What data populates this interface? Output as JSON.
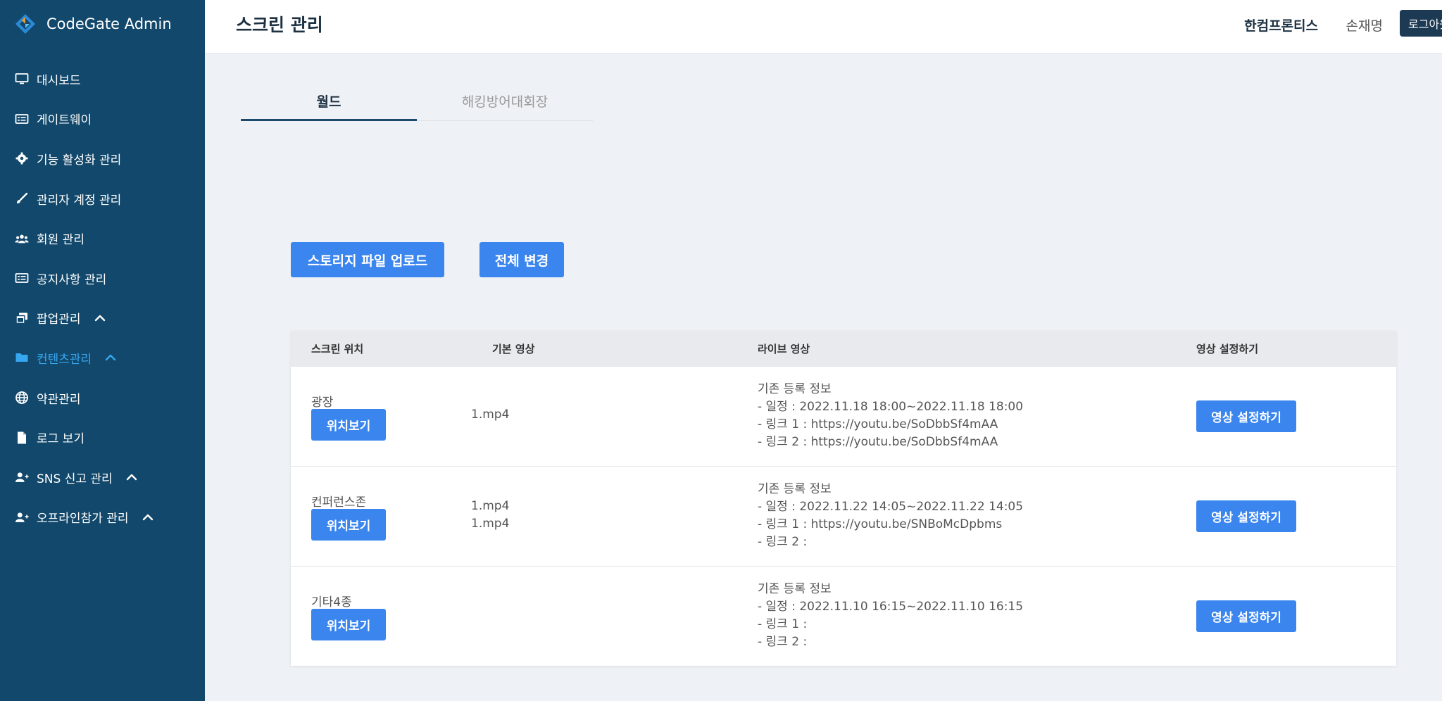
{
  "app": {
    "name": "CodeGate Admin"
  },
  "sidebar": {
    "items": [
      {
        "label": "대시보드",
        "icon": "monitor-icon"
      },
      {
        "label": "게이트웨이",
        "icon": "list-icon"
      },
      {
        "label": "기능 활성화 관리",
        "icon": "gear-icon"
      },
      {
        "label": "관리자 계정 관리",
        "icon": "brush-icon"
      },
      {
        "label": "회원 관리",
        "icon": "users-icon"
      },
      {
        "label": "공지사항 관리",
        "icon": "list-icon"
      },
      {
        "label": "팝업관리",
        "icon": "windows-icon",
        "expand": true
      },
      {
        "label": "컨텐츠관리",
        "icon": "folder-icon",
        "expand": true,
        "active": true
      },
      {
        "label": "약관관리",
        "icon": "globe-icon"
      },
      {
        "label": "로그 보기",
        "icon": "file-icon"
      },
      {
        "label": "SNS 신고 관리",
        "icon": "user-plus-icon",
        "expand": true
      },
      {
        "label": "오프라인참가 관리",
        "icon": "user-plus-icon",
        "expand": true
      }
    ]
  },
  "header": {
    "title": "스크린 관리",
    "company": "한컴프론티스",
    "user": "손재명",
    "logout": "로그아웃"
  },
  "tabs": [
    {
      "label": "월드",
      "active": true
    },
    {
      "label": "해킹방어대회장",
      "active": false
    }
  ],
  "actions": {
    "upload": "스토리지 파일 업로드",
    "change_all": "전체 변경"
  },
  "table": {
    "headers": [
      "스크린 위치",
      "기본 영상",
      "라이브 영상",
      "영상 설정하기"
    ],
    "rows": [
      {
        "location": "광장",
        "location_button": "위치보기",
        "basic": [
          "1.mp4"
        ],
        "live": [
          "기존 등록 정보",
          "- 일정 : 2022.11.18 18:00~2022.11.18 18:00",
          "- 링크 1 : https://youtu.be/SoDbbSf4mAA",
          "- 링크 2 : https://youtu.be/SoDbbSf4mAA"
        ],
        "video_button": "영상 설정하기"
      },
      {
        "location": "컨퍼런스존",
        "location_button": "위치보기",
        "basic": [
          "1.mp4",
          "1.mp4"
        ],
        "live": [
          "기존 등록 정보",
          "- 일정 : 2022.11.22 14:05~2022.11.22 14:05",
          "- 링크 1 : https://youtu.be/SNBoMcDpbms",
          "- 링크 2 :"
        ],
        "video_button": "영상 설정하기"
      },
      {
        "location": "기타4종",
        "location_button": "위치보기",
        "basic": [],
        "live": [
          "기존 등록 정보",
          "- 일정 : 2022.11.10 16:15~2022.11.10 16:15",
          "- 링크 1 :",
          "- 링크 2 :"
        ],
        "video_button": "영상 설정하기"
      }
    ]
  },
  "colors": {
    "sidebar_bg": "#12486b",
    "accent": "#3a85ee",
    "active_nav": "#37a7f0"
  }
}
